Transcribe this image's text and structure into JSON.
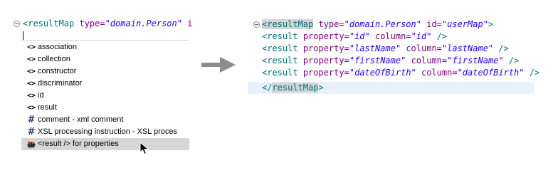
{
  "left_editor": {
    "line1": {
      "tag_open": "<resultMap",
      "attr_type": "type=",
      "val_type": "\"domain.Person\"",
      "attr_id": "i"
    },
    "completion": [
      {
        "icon": "xml-tag-icon",
        "glyph": "<>",
        "label": "association"
      },
      {
        "icon": "xml-tag-icon",
        "glyph": "<>",
        "label": "collection"
      },
      {
        "icon": "xml-tag-icon",
        "glyph": "<>",
        "label": "constructor"
      },
      {
        "icon": "xml-tag-icon",
        "glyph": "<>",
        "label": "discriminator"
      },
      {
        "icon": "xml-tag-icon",
        "glyph": "<>",
        "label": "id"
      },
      {
        "icon": "xml-tag-icon",
        "glyph": "<>",
        "label": "result"
      },
      {
        "icon": "hash-icon",
        "glyph": "#",
        "label": "comment - xml comment"
      },
      {
        "icon": "hash-icon",
        "glyph": "#",
        "label": "XSL processing instruction - XSL proces"
      },
      {
        "icon": "template-icon",
        "glyph": "",
        "label": "<result /> for properties"
      }
    ],
    "selected_index": 8
  },
  "right_editor": {
    "line1": {
      "tag": "<resultMap",
      "sp1": " ",
      "attr_type": "type=",
      "val_type": "\"domain.Person\"",
      "sp2": " ",
      "attr_id": "id=",
      "val_id": "\"userMap\"",
      "close": ">"
    },
    "rows": [
      {
        "tag": "<result",
        "a1": "property=",
        "v1": "\"id\"",
        "a2": "column=",
        "v2": "\"id\"",
        "end": "/>"
      },
      {
        "tag": "<result",
        "a1": "property=",
        "v1": "\"lastName\"",
        "a2": "column=",
        "v2": "\"lastName\"",
        "end": "/>"
      },
      {
        "tag": "<result",
        "a1": "property=",
        "v1": "\"firstName\"",
        "a2": "column=",
        "v2": "\"firstName\"",
        "end": "/>"
      },
      {
        "tag": "<result",
        "a1": "property=",
        "v1": "\"dateOfBirth\"",
        "a2": "column=",
        "v2": "\"dateOfBirth\"",
        "end": "/>"
      }
    ],
    "closing": {
      "lt": "</",
      "name": "resultMap",
      "gt": ">"
    }
  },
  "colors": {
    "tag": "#00707a",
    "attr": "#7f007f",
    "value": "#2a00ff",
    "selection": "#d6d6d6",
    "current_line": "#e8f2fe"
  }
}
